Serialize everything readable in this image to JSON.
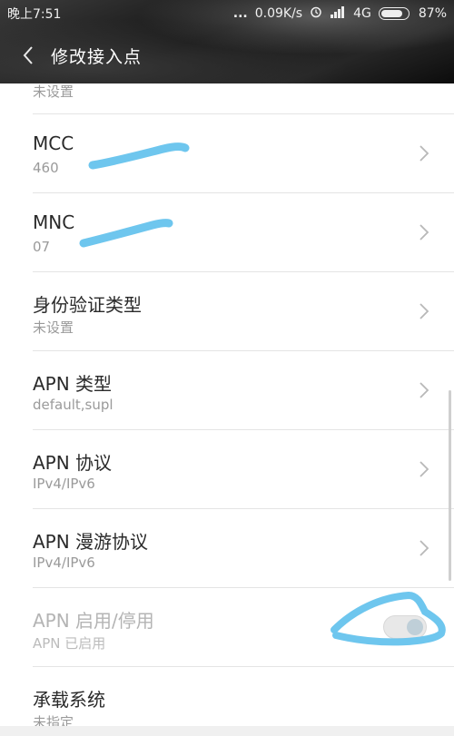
{
  "status_bar": {
    "time": "晚上7:51",
    "dots": "...",
    "speed": "0.09K/s",
    "network": "4G",
    "battery": "87%",
    "battery_level": 0.87
  },
  "header": {
    "title": "修改接入点"
  },
  "partial_row": {
    "sub": "未设置"
  },
  "rows": [
    {
      "main": "MCC",
      "sub": "460"
    },
    {
      "main": "MNC",
      "sub": "07"
    },
    {
      "main": "身份验证类型",
      "sub": "未设置"
    },
    {
      "main": "APN 类型",
      "sub": "default,supl"
    },
    {
      "main": "APN 协议",
      "sub": "IPv4/IPv6"
    },
    {
      "main": "APN 漫游协议",
      "sub": "IPv4/IPv6"
    },
    {
      "main": "APN 启用/停用",
      "sub": "APN 已启用"
    },
    {
      "main": "承载系统",
      "sub": "未指定"
    }
  ],
  "colors": {
    "annotation": "#6ec6ee",
    "divider": "#e4e4e4"
  },
  "icons": {
    "back": "chevron-left-icon",
    "row_action": "chevron-right-icon",
    "alarm": "alarm-icon",
    "signal": "signal-icon",
    "battery": "battery-icon"
  }
}
